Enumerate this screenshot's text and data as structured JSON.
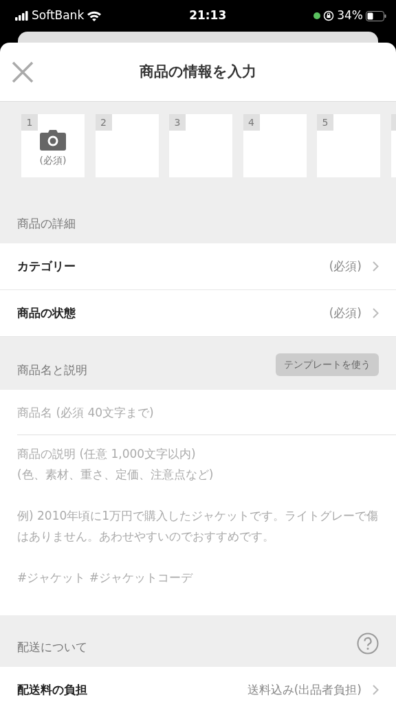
{
  "status_bar": {
    "carrier": "SoftBank",
    "time": "21:13",
    "battery": "34%"
  },
  "header": {
    "title": "商品の情報を入力"
  },
  "photo_slots": [
    {
      "number": "1",
      "label": "(必須)"
    },
    {
      "number": "2"
    },
    {
      "number": "3"
    },
    {
      "number": "4"
    },
    {
      "number": "5"
    }
  ],
  "details": {
    "heading": "商品の詳細",
    "rows": [
      {
        "label": "カテゴリー",
        "value": "(必須)"
      },
      {
        "label": "商品の状態",
        "value": "(必須)"
      }
    ]
  },
  "name_description": {
    "heading": "商品名と説明",
    "template_button": "テンプレートを使う",
    "name_placeholder": "商品名 (必須 40文字まで)",
    "description_placeholder": "商品の説明 (任意 1,000文字以内)\n(色、素材、重さ、定価、注意点など)\n\n例) 2010年頃に1万円で購入したジャケットです。ライトグレーで傷はありません。あわせやすいのでおすすめです。\n\n#ジャケット #ジャケットコーデ"
  },
  "shipping": {
    "heading": "配送について",
    "rows": [
      {
        "label": "配送料の負担",
        "value": "送料込み(出品者負担)"
      }
    ]
  }
}
